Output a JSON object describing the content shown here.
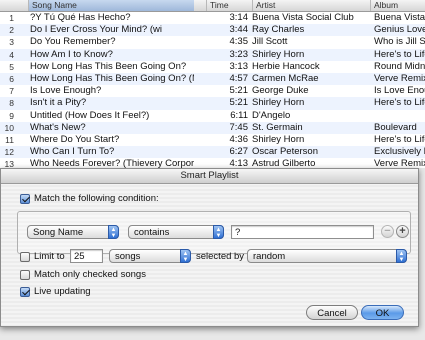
{
  "library": {
    "columns": {
      "song": "Song Name",
      "time": "Time",
      "artist": "Artist",
      "album": "Album"
    },
    "rows": [
      {
        "num": "1",
        "song": "?Y Tú Qué Has Hecho?",
        "time": "3:14",
        "artist": "Buena Vista Social Club",
        "album": "Buena Vista S"
      },
      {
        "num": "2",
        "song": "Do I Ever Cross Your Mind? (wi",
        "time": "3:44",
        "artist": "Ray Charles",
        "album": "Genius Loves"
      },
      {
        "num": "3",
        "song": "Do You Remember?",
        "time": "4:35",
        "artist": "Jill Scott",
        "album": "Who is Jill Sc"
      },
      {
        "num": "4",
        "song": "How Am I to Know?",
        "time": "3:23",
        "artist": "Shirley Horn",
        "album": "Here's to Life"
      },
      {
        "num": "5",
        "song": "How Long Has This Been Going On?",
        "time": "3:13",
        "artist": "Herbie Hancock",
        "album": "Round Midnig"
      },
      {
        "num": "6",
        "song": "How Long Has This Been Going On? (MJ C...",
        "time": "4:57",
        "artist": "Carmen McRae",
        "album": "Verve Remixe"
      },
      {
        "num": "7",
        "song": "Is Love Enough?",
        "time": "5:21",
        "artist": "George Duke",
        "album": "Is Love Enoug"
      },
      {
        "num": "8",
        "song": "Isn't it a Pity?",
        "time": "5:21",
        "artist": "Shirley Horn",
        "album": "Here's to Life"
      },
      {
        "num": "9",
        "song": "Untitled (How Does It Feel?)",
        "time": "6:11",
        "artist": "D'Angelo",
        "album": ""
      },
      {
        "num": "10",
        "song": "What's New?",
        "time": "7:45",
        "artist": "St. Germain",
        "album": "Boulevard"
      },
      {
        "num": "11",
        "song": "Where Do You Start?",
        "time": "4:36",
        "artist": "Shirley Horn",
        "album": "Here's to Life"
      },
      {
        "num": "12",
        "song": "Who Can I Turn To?",
        "time": "6:27",
        "artist": "Oscar Peterson",
        "album": "Exclusively Fo"
      },
      {
        "num": "13",
        "song": "Who Needs Forever? (Thievery Corporatio...",
        "time": "4:13",
        "artist": "Astrud Gilberto",
        "album": "Verve Remixe"
      }
    ]
  },
  "dialog": {
    "title": "Smart Playlist",
    "match_label": "Match the following condition:",
    "match_checked": true,
    "rule": {
      "field": "Song Name",
      "operator": "contains",
      "value": "?",
      "remove_symbol": "−",
      "add_symbol": "+"
    },
    "limit": {
      "label": "Limit to",
      "checked": false,
      "amount": "25",
      "unit": "songs",
      "selected_by_label": "selected by",
      "selected_by": "random"
    },
    "checked_only_label": "Match only checked songs",
    "checked_only": false,
    "live_label": "Live updating",
    "live_checked": true,
    "cancel_label": "Cancel",
    "ok_label": "OK"
  },
  "icons": {
    "row_link": "arrow-circle-icon",
    "row_check": "checkbox-checked-icon",
    "popup": "up-down-arrows-icon"
  },
  "colors": {
    "row_stripe": "#edf3fe",
    "accent_blue": "#5b9ae8"
  }
}
